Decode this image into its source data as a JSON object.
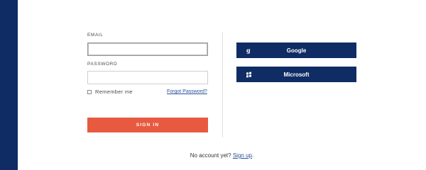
{
  "form": {
    "email_label": "EMAIL",
    "email_value": "",
    "password_label": "PASSWORD",
    "password_value": "",
    "remember_label": "Remember me",
    "forgot_label": "Forgot Password?",
    "signin_label": "SIGN IN"
  },
  "social": {
    "google": {
      "label": "Google",
      "icon": "google-g-icon",
      "glyph": "g"
    },
    "microsoft": {
      "label": "Microsoft",
      "icon": "windows-logo-icon"
    }
  },
  "footer": {
    "prompt": "No account yet?",
    "signup_label": "Sign up",
    "suffix": "."
  },
  "colors": {
    "brand_navy": "#0f2d64",
    "signin_orange": "#e85a40",
    "link_blue": "#2a4f9a"
  }
}
